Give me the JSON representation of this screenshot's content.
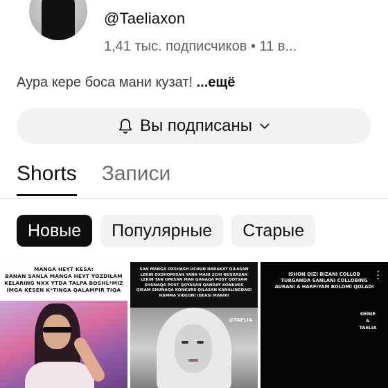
{
  "channel": {
    "handle": "@Taeliaxon",
    "stats": "1,41 тыс. подписчиков • 11 в...",
    "description": "Аура кере боса мани кузат!",
    "more_label": "...ещё"
  },
  "subscribe_button": {
    "icon": "bell-icon",
    "label": "Вы подписаны",
    "chevron": "chevron-down-icon"
  },
  "tabs": [
    {
      "label": "Shorts",
      "active": true
    },
    {
      "label": "Записи",
      "active": false
    }
  ],
  "chips": [
    {
      "label": "Новые",
      "active": true
    },
    {
      "label": "Популярные",
      "active": false
    },
    {
      "label": "Старые",
      "active": false
    }
  ],
  "shorts": [
    {
      "caption_lines": [
        "MANGA HEYT KESA:",
        "BANAN SANLA MANGA HEYT YOZDILAM",
        "KELARING NXX YTDA TALPA BOSHL*MIZ",
        "IMGA KESEN K*TINGA QALAMPIR TIQA"
      ]
    },
    {
      "caption_lines": [
        "SAN MANGA OXSHASH UCHUN HARAKAT QILASAN",
        "LEKIN OXSHOMISAN YANA MANI 2CHI NUSXASAN",
        "LEKIN TAN OMISAN MAN QANAQA POST QOYSAM",
        "SHUNAQA POST QOYASAN QANDAY KONKURS",
        "QISAM SHUNAQA KONKURS QILASAN KANALINGDAGI",
        "HAMMA VIDEONI IDEASI MANIKI"
      ],
      "watermark": "@TAELIA"
    },
    {
      "caption_lines": [
        "ISHON QIZI BIZANI COLLOB",
        "TURGANDA SANLANI COLLOBING",
        "AURANI A HARFIYAM BOLOMI QOLADI"
      ],
      "signature_lines": [
        "DENIE",
        "&",
        "TAELIA"
      ]
    }
  ],
  "colors": {
    "background": "#ffffff",
    "text": "#0f0f0f",
    "muted": "#606060",
    "chip_bg": "#f2f2f2",
    "chip_active_bg": "#0f0f0f"
  }
}
